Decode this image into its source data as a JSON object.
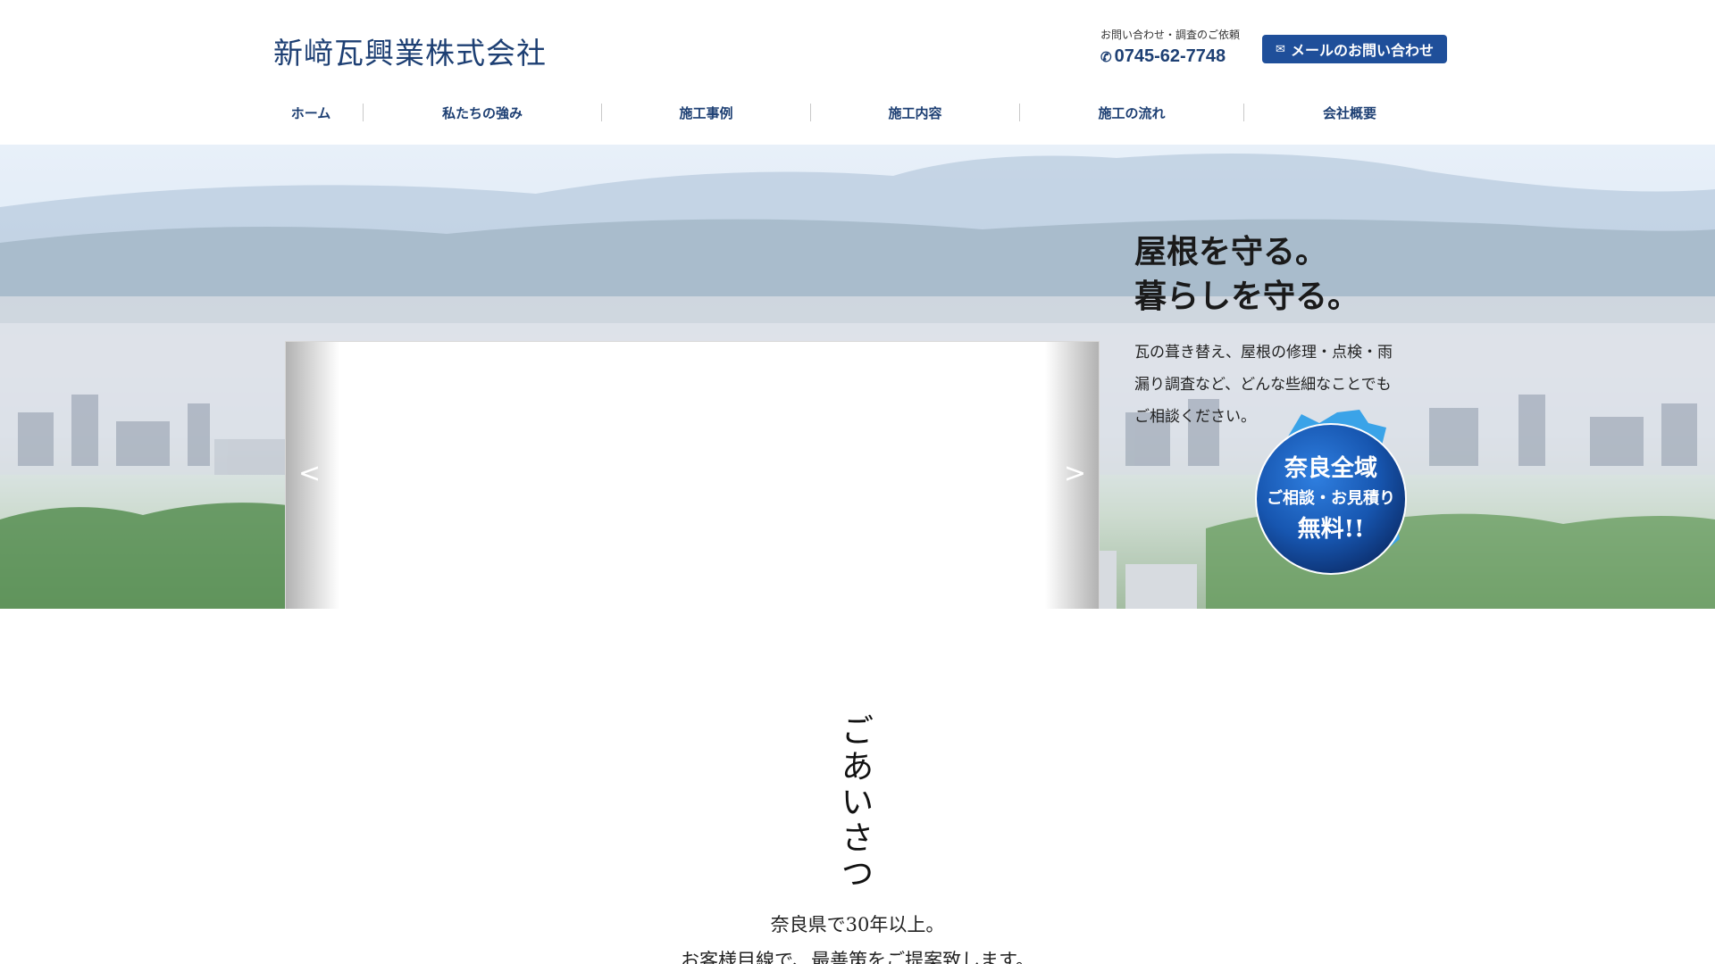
{
  "header": {
    "logo": "新﨑瓦興業株式会社",
    "contact_label": "お問い合わせ・調査のご依頼",
    "phone_icon": "phone-icon",
    "phone": "0745-62-7748",
    "mail_icon": "envelope-icon",
    "mail_button": "メールのお問い合わせ",
    "accent_color": "#1f4f9a",
    "text_color": "#1d3f73"
  },
  "nav": {
    "items": [
      {
        "label": "ホーム"
      },
      {
        "label": "私たちの強み"
      },
      {
        "label": "施工事例"
      },
      {
        "label": "施工内容"
      },
      {
        "label": "施工の流れ"
      },
      {
        "label": "会社概要"
      }
    ]
  },
  "hero": {
    "slider_prev": "<",
    "slider_next": ">",
    "catch_line1": "屋根を守る。",
    "catch_line2": "暮らしを守る。",
    "sub_line1": "瓦の葺き替え、屋根の修理・点検・雨",
    "sub_line2": "漏り調査など、どんな些細なことでも",
    "sub_line3": "ご相談ください。",
    "badge_line1": "奈良全域",
    "badge_line2": "ご相談・お見積り",
    "badge_line3": "無料!!",
    "badge_color": "#1756b0"
  },
  "greeting": {
    "title_chars": [
      "ご",
      "あ",
      "い",
      "さ",
      "つ"
    ],
    "line1": "奈良県で30年以上。",
    "line2": "お客様目線で、最善策をご提案致します。"
  }
}
